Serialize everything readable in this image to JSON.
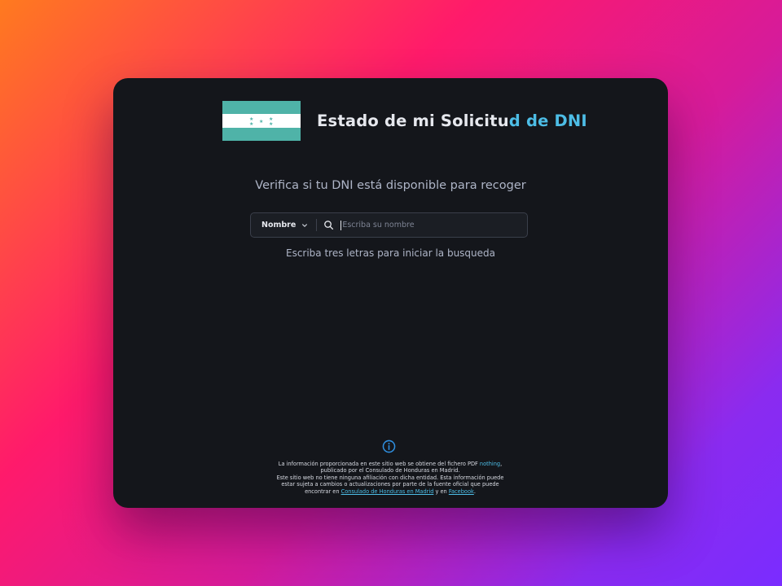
{
  "header": {
    "title_main": "Estado de mi Solicitu",
    "title_accent_d": "d",
    "title_accent_rest": " de DNI",
    "flag_name": "honduras-flag"
  },
  "subtitle": "Verifica si tu DNI está disponible para recoger",
  "search": {
    "field_select_value": "Nombre",
    "placeholder": "Escriba su nombre",
    "value": ""
  },
  "hint": "Escriba tres letras para iniciar la busqueda",
  "footer": {
    "line1_pre": "La información proporcionada en este sitio web se obtiene del fichero PDF ",
    "line1_link": "nothing",
    "line1_post": ",",
    "line2": "publicado por el Consulado de Honduras en Madrid.",
    "line3": "Este sitio web no tiene ninguna afiliación con dicha entidad. Esta información puede",
    "line4": "estar sujeta a cambios o actualizaciones por parte de la fuente oficial que puede",
    "line5_pre": "encontrar en ",
    "line5_link1": "Consulado de Honduras en Madrid",
    "line5_mid": " y en ",
    "line5_link2": "Facebook",
    "line5_post": "."
  },
  "colors": {
    "accent": "#4dbde6",
    "window_bg": "#14161b",
    "flag_teal": "#4fb3a8"
  }
}
